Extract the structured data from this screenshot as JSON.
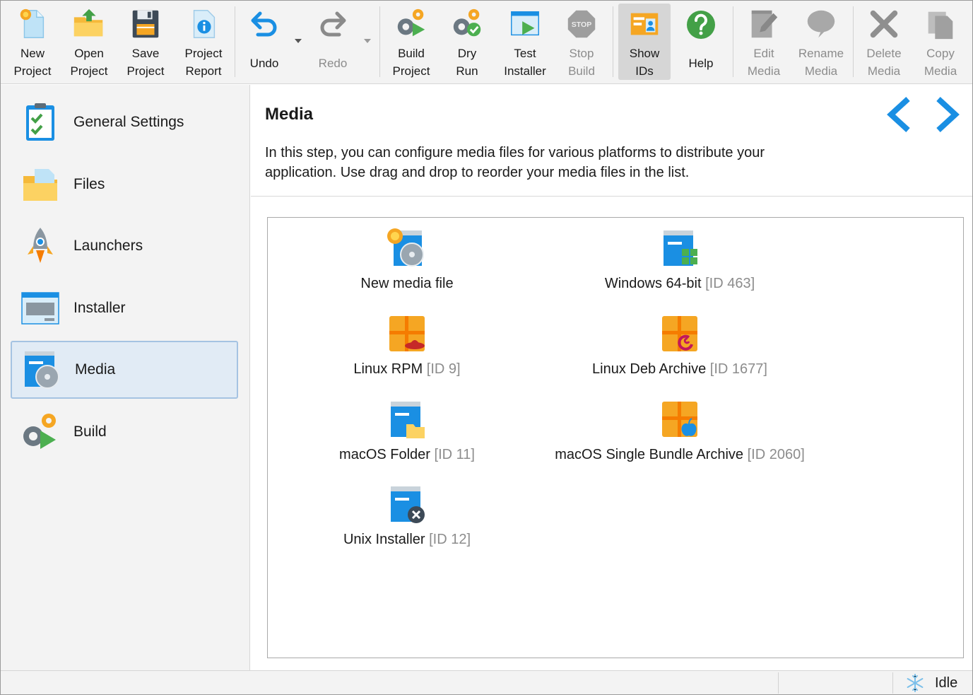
{
  "toolbar": {
    "new_project": "New\nProject",
    "open_project": "Open\nProject",
    "save_project": "Save\nProject",
    "project_report": "Project\nReport",
    "undo": "Undo",
    "redo": "Redo",
    "build_project": "Build\nProject",
    "dry_run": "Dry\nRun",
    "test_installer": "Test\nInstaller",
    "stop_build": "Stop\nBuild",
    "show_ids": "Show\nIDs",
    "help": "Help",
    "edit_media": "Edit\nMedia",
    "rename_media": "Rename\nMedia",
    "delete_media": "Delete\nMedia",
    "copy_media": "Copy\nMedia",
    "stop_icon_text": "STOP"
  },
  "sidebar": {
    "items": [
      {
        "label": "General Settings"
      },
      {
        "label": "Files"
      },
      {
        "label": "Launchers"
      },
      {
        "label": "Installer"
      },
      {
        "label": "Media"
      },
      {
        "label": "Build"
      }
    ]
  },
  "main": {
    "title": "Media",
    "description": "In this step, you can configure media files for various platforms to distribute your application. Use drag and drop to reorder your media files in the list.",
    "media": [
      {
        "name": "New media file",
        "id": ""
      },
      {
        "name": "Windows 64-bit",
        "id": "[ID 463]"
      },
      {
        "name": "Linux RPM",
        "id": "[ID 9]"
      },
      {
        "name": "Linux Deb Archive",
        "id": "[ID 1677]"
      },
      {
        "name": "macOS Folder",
        "id": "[ID 11]"
      },
      {
        "name": "macOS Single Bundle Archive",
        "id": "[ID 2060]"
      },
      {
        "name": "Unix Installer",
        "id": "[ID 12]"
      }
    ]
  },
  "status": {
    "state": "Idle"
  },
  "colors": {
    "accent_blue": "#1a8fe3",
    "selection_bg": "#e1ebf5",
    "selection_border": "#a5c3e2",
    "disabled_text": "#8c8c8c",
    "orange": "#f5a623",
    "green": "#4caf50"
  }
}
